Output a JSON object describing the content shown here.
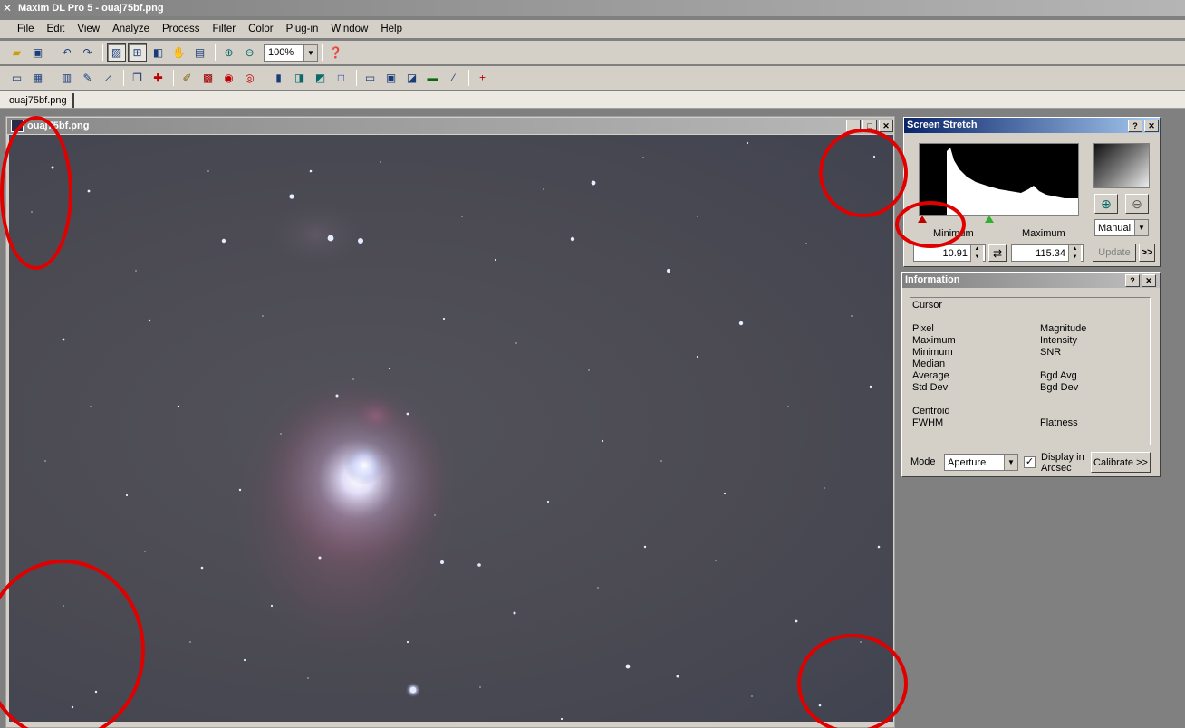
{
  "app": {
    "title": "MaxIm DL Pro 5 - ouaj75bf.png"
  },
  "menu": [
    "File",
    "Edit",
    "View",
    "Analyze",
    "Process",
    "Filter",
    "Color",
    "Plug-in",
    "Window",
    "Help"
  ],
  "toolbar": {
    "zoom": "100%"
  },
  "tabs": [
    {
      "label": "ouaj75bf.png"
    }
  ],
  "image_window": {
    "title": "ouaj75bf.png"
  },
  "screen_stretch": {
    "title": "Screen Stretch",
    "minimum_label": "Minimum",
    "maximum_label": "Maximum",
    "minimum_value": "10.91",
    "maximum_value": "115.34",
    "mode": "Manual",
    "update_label": "Update",
    "more_label": ">>"
  },
  "information": {
    "title": "Information",
    "cursor_label": "Cursor",
    "left_labels": [
      "Pixel",
      "Maximum",
      "Minimum",
      "Median",
      "Average",
      "Std Dev"
    ],
    "right_labels": [
      "Magnitude",
      "Intensity",
      "SNR",
      "",
      "Bgd Avg",
      "Bgd Dev"
    ],
    "centroid_label": "Centroid",
    "fwhm_label": "FWHM",
    "flatness_label": "Flatness",
    "mode_label": "Mode",
    "mode_value": "Aperture",
    "display_arcsec_label_1": "Display in",
    "display_arcsec_label_2": "Arcsec",
    "display_arcsec_checked": true,
    "calibrate_label": "Calibrate >>"
  },
  "colors": {
    "annotation": "#e00000",
    "active_title": "#0a246a"
  }
}
